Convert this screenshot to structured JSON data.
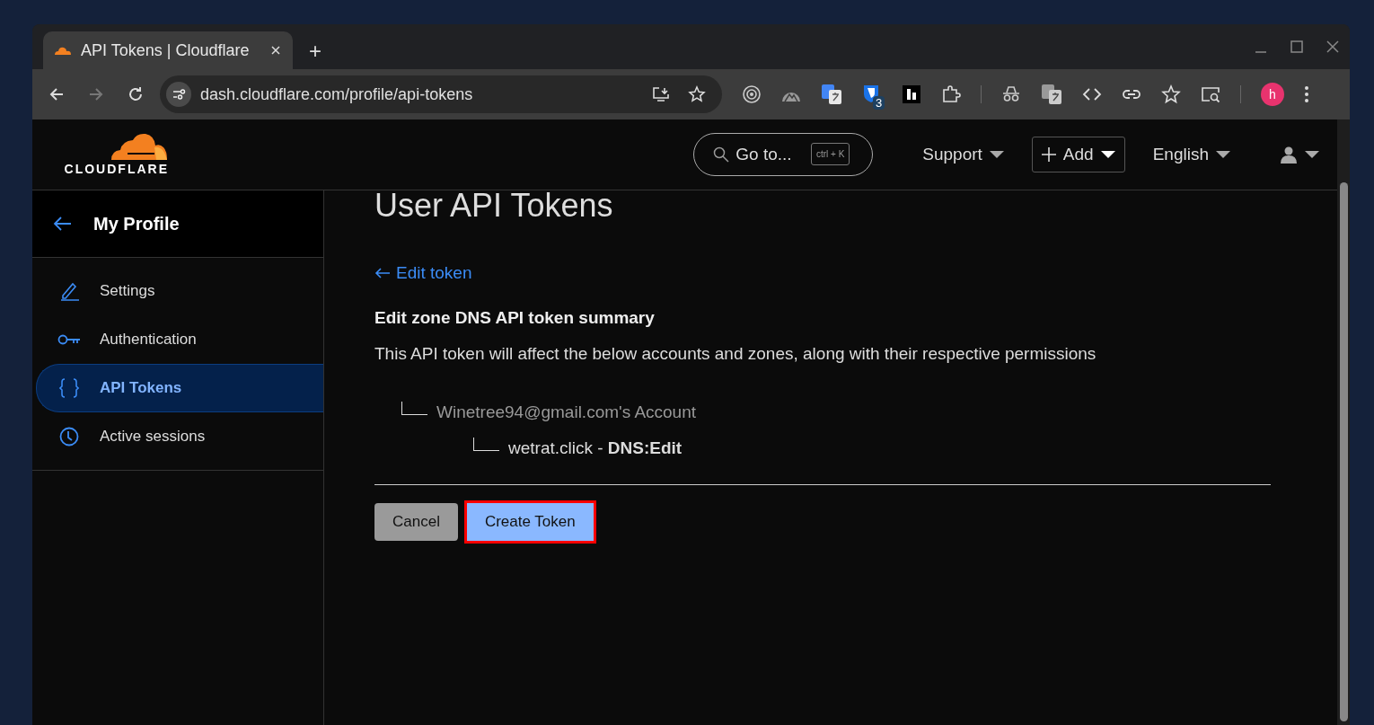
{
  "browser": {
    "tab_title": "API Tokens | Cloudflare",
    "new_tab": "+",
    "url": "dash.cloudflare.com/profile/api-tokens",
    "extension_badge": "3",
    "avatar_letter": "h"
  },
  "header": {
    "logo_text": "CLOUDFLARE",
    "search_placeholder": "Go to...",
    "shortcut": "ctrl + K",
    "menus": [
      {
        "label": "Support",
        "kind": "menu"
      },
      {
        "label": "Add",
        "kind": "add"
      },
      {
        "label": "English",
        "kind": "menu"
      }
    ]
  },
  "sidebar": {
    "back_title": "My Profile",
    "items": [
      {
        "label": "Settings",
        "selected": false
      },
      {
        "label": "Authentication",
        "selected": false
      },
      {
        "label": "API Tokens",
        "selected": true
      },
      {
        "label": "Active sessions",
        "selected": false
      }
    ]
  },
  "main": {
    "title": "User API Tokens",
    "back_link": "Edit token",
    "summary_title": "Edit zone DNS API token summary",
    "description": "This API token will affect the below accounts and zones, along with their respective permissions",
    "tree": [
      {
        "label": "Winetree94@gmail.com's Account",
        "children": [
          {
            "label": "wetrat.click - **DNS:Edit**"
          }
        ]
      }
    ],
    "buttons": [
      {
        "label": "Cancel",
        "kind": "secondary",
        "highlighted": false
      },
      {
        "label": "Create Token",
        "kind": "primary",
        "highlighted": true
      }
    ]
  }
}
